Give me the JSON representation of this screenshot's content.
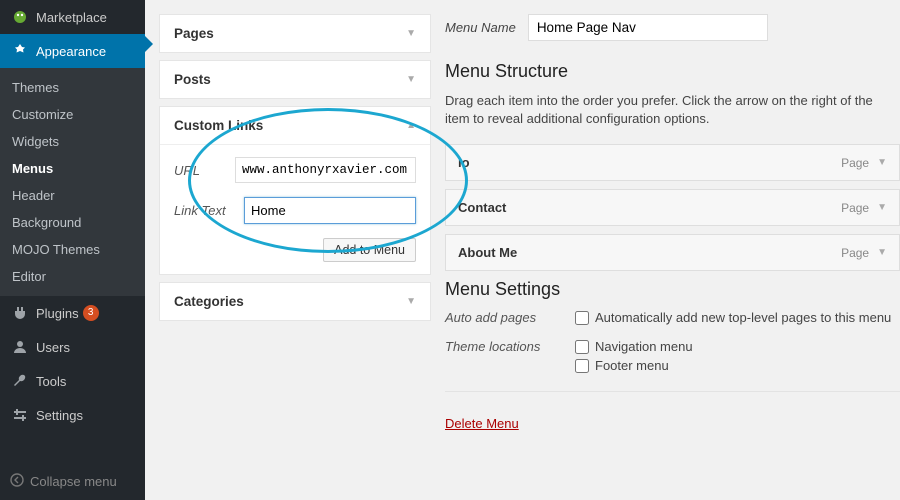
{
  "sidebar": {
    "marketplace": "Marketplace",
    "appearance": "Appearance",
    "sub": {
      "themes": "Themes",
      "customize": "Customize",
      "widgets": "Widgets",
      "menus": "Menus",
      "header": "Header",
      "background": "Background",
      "mojo": "MOJO Themes",
      "editor": "Editor"
    },
    "plugins": "Plugins",
    "plugins_badge": "3",
    "users": "Users",
    "tools": "Tools",
    "settings": "Settings",
    "collapse": "Collapse menu"
  },
  "accordions": {
    "pages": "Pages",
    "posts": "Posts",
    "custom_links": "Custom Links",
    "categories": "Categories"
  },
  "custom_links_form": {
    "url_label": "URL",
    "url_value": "www.anthonyrxavier.com",
    "link_text_label": "Link Text",
    "link_text_value": "Home",
    "add_button": "Add to Menu"
  },
  "menu": {
    "name_label": "Menu Name",
    "name_value": "Home Page Nav",
    "structure_heading": "Menu Structure",
    "structure_help": "Drag each item into the order you prefer. Click the arrow on the right of the item to reveal additional configuration options.",
    "items": [
      {
        "label": "io",
        "type": "Page"
      },
      {
        "label": "Contact",
        "type": "Page"
      },
      {
        "label": "About Me",
        "type": "Page"
      }
    ],
    "settings_heading": "Menu Settings",
    "auto_add_label": "Auto add pages",
    "auto_add_checkbox": "Automatically add new top-level pages to this menu",
    "locations_label": "Theme locations",
    "loc_nav": "Navigation menu",
    "loc_footer": "Footer menu",
    "delete": "Delete Menu"
  }
}
